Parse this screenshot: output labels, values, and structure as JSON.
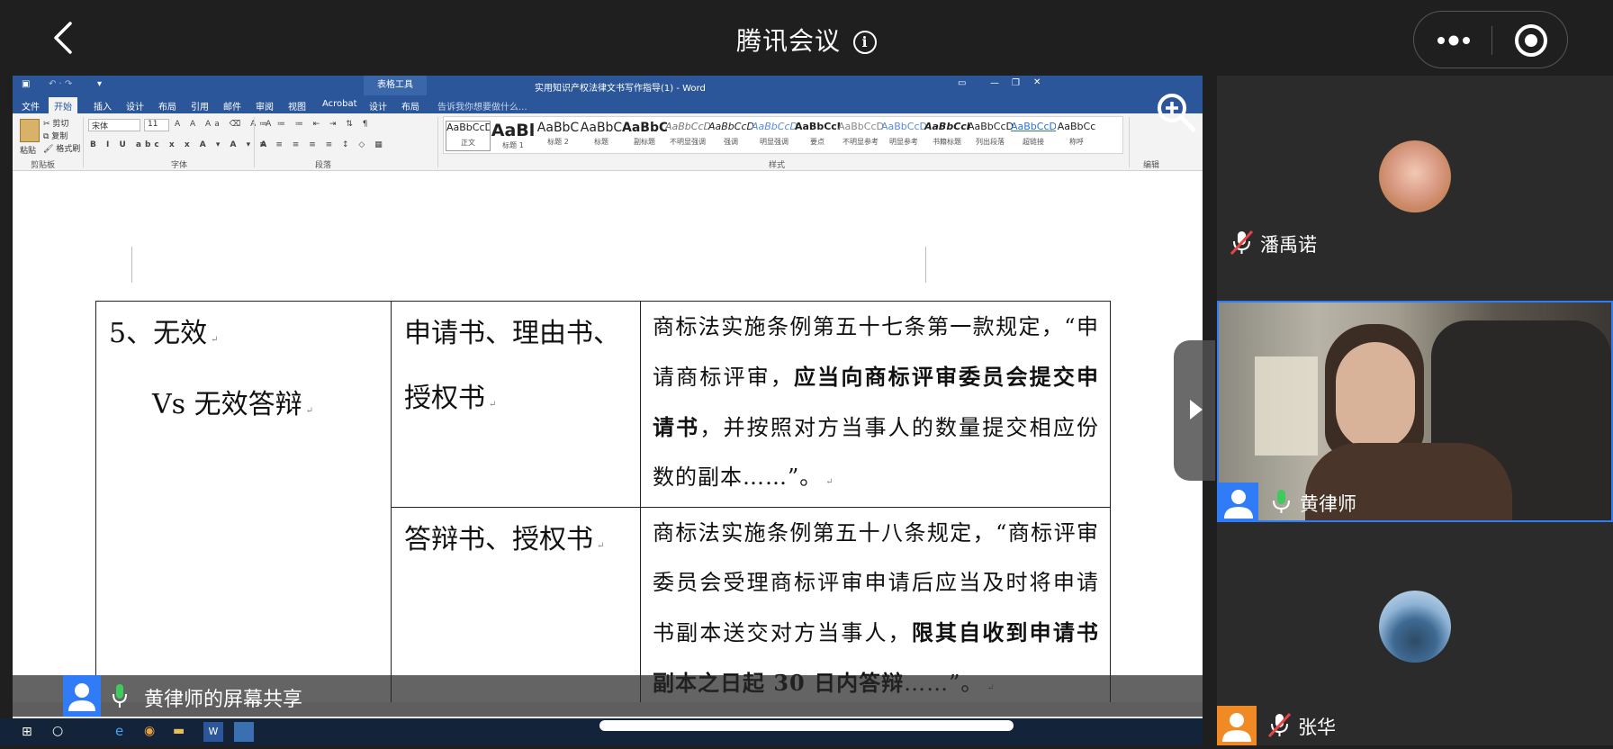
{
  "meeting": {
    "title": "腾讯会议"
  },
  "word": {
    "window_title": "实用知识产权法律文书写作指导(1) - Word",
    "context_tab_group": "表格工具",
    "tabs": [
      "文件",
      "开始",
      "插入",
      "设计",
      "布局",
      "引用",
      "邮件",
      "审阅",
      "视图",
      "Acrobat",
      "设计",
      "布局"
    ],
    "tell_me": "告诉我你想要做什么...",
    "font_name": "宋体",
    "font_size": "11",
    "clipboard": {
      "paste": "粘贴",
      "cut": "剪切",
      "copy": "复制",
      "format": "格式刷"
    },
    "groups": [
      "剪贴板",
      "字体",
      "段落",
      "样式",
      "编辑"
    ],
    "styles": [
      {
        "sample": "AaBbCcDi",
        "name": "正文"
      },
      {
        "sample": "AaBl",
        "name": "标题 1"
      },
      {
        "sample": "AaBbC",
        "name": "标题 2"
      },
      {
        "sample": "AaBbC",
        "name": "标题"
      },
      {
        "sample": "AaBbC",
        "name": "副标题"
      },
      {
        "sample": "AaBbCcDi",
        "name": "不明显强调"
      },
      {
        "sample": "AaBbCcD",
        "name": "强调"
      },
      {
        "sample": "AaBbCcD",
        "name": "明显强调"
      },
      {
        "sample": "AaBbCcD",
        "name": "要点"
      },
      {
        "sample": "AaBbCcD",
        "name": "不明显参考"
      },
      {
        "sample": "AaBbCcD",
        "name": "明显参考"
      },
      {
        "sample": "AaBbCcD",
        "name": "书籍标题"
      },
      {
        "sample": "AaBbCcD",
        "name": "列出段落"
      },
      {
        "sample": "AaBbCcD",
        "name": "超链接"
      },
      {
        "sample": "AaBbCc",
        "name": "称呼"
      }
    ],
    "table": {
      "col1_line1": "5、无效",
      "col1_line2": "Vs 无效答辩",
      "row1_col2_line1": "申请书、理由书、",
      "row1_col2_line2": "授权书",
      "row1_col3_a": "商标法实施条例第五十七条第一款规定，“申请商标评审，",
      "row1_col3_bold": "应当向商标评审委员会提交申请书",
      "row1_col3_b": "，并按照对方当事人的数量提交相应份数的副本……”。",
      "row2_col2": "答辩书、授权书",
      "row2_col3_a": "商标法实施条例第五十八条规定，“商标评审委员会受理商标评审申请后应当及时将申请书副本送交对方当事人，",
      "row2_col3_bold": "限其自收到申请书副本之日起 30 日内答辩",
      "row2_col3_b": "……”。"
    }
  },
  "share_banner": {
    "text": "黄律师的屏幕共享"
  },
  "participants": [
    {
      "name": "潘禹诺",
      "mic": "muted"
    },
    {
      "name": "黄律师",
      "mic": "on"
    },
    {
      "name": "张华",
      "mic": "muted"
    }
  ],
  "colors": {
    "meeting_bg": "#1f1f1f",
    "word_blue": "#2b579a",
    "accent_blue": "#2f7cf6",
    "mic_green": "#3ecb5d",
    "avatar_orange": "#f08a24"
  }
}
